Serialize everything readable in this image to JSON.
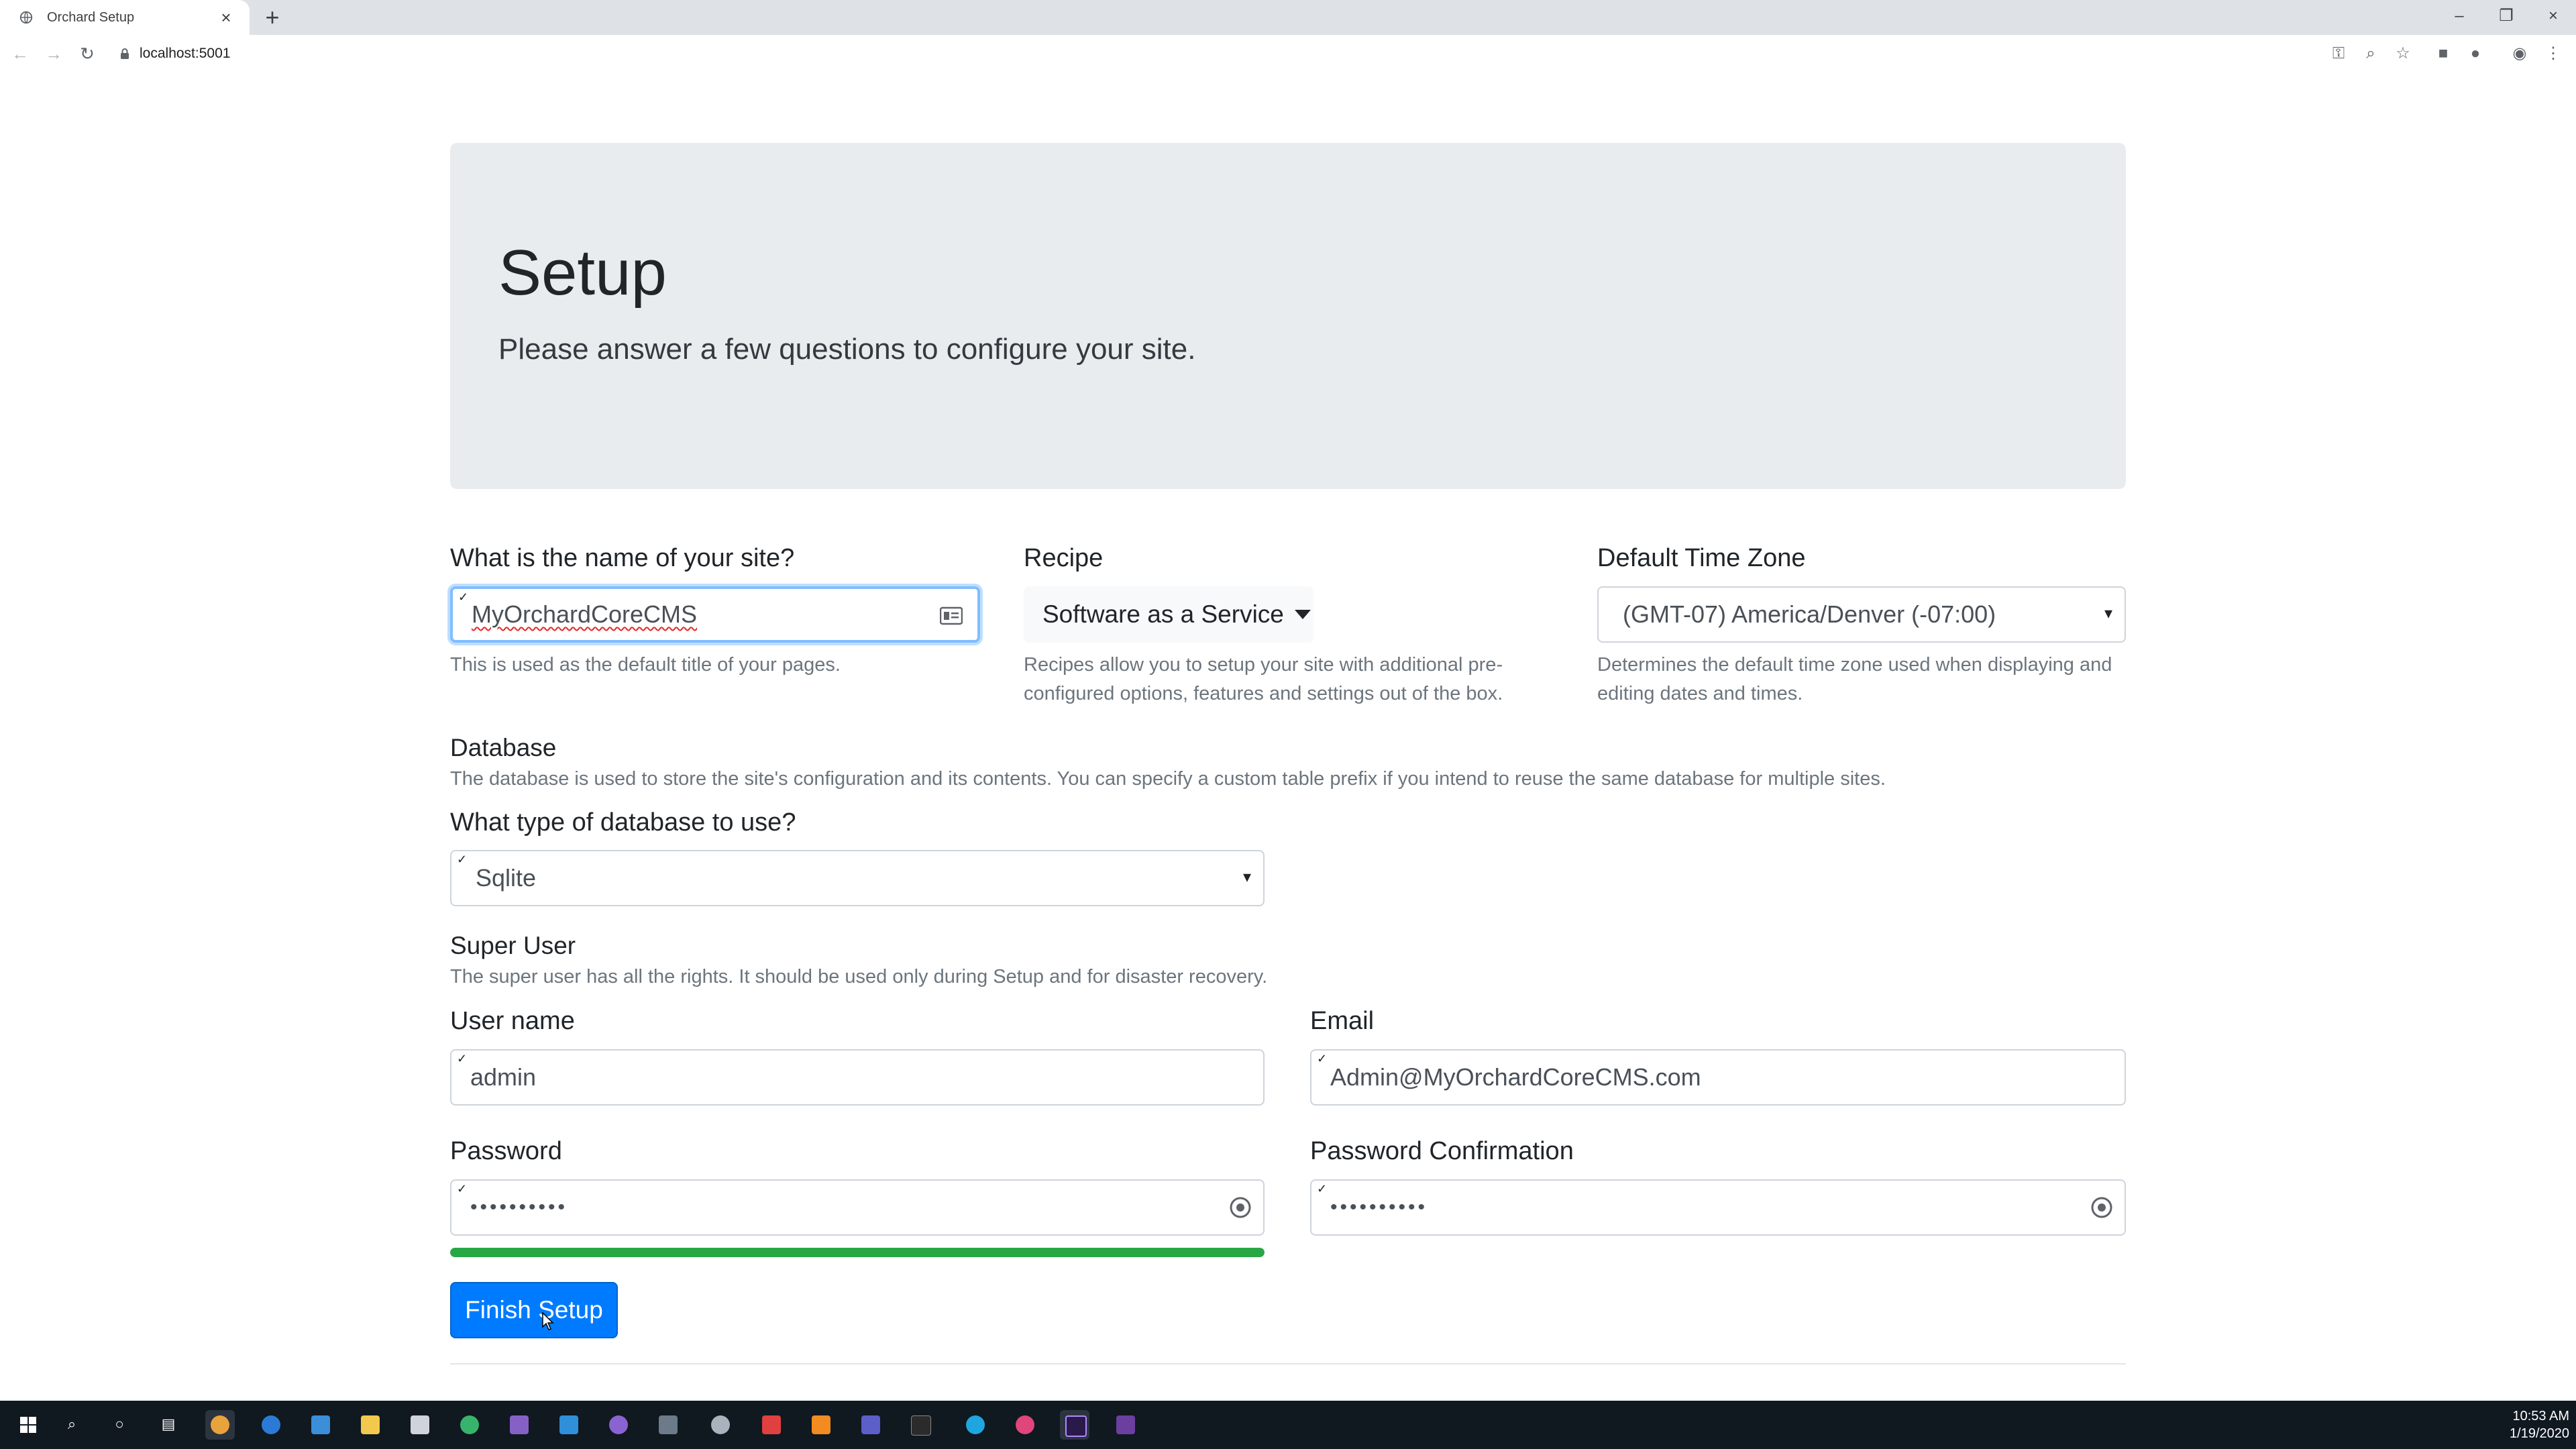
{
  "browser": {
    "tab_title": "Orchard Setup",
    "url": "localhost:5001"
  },
  "jumbotron": {
    "title": "Setup",
    "lead": "Please answer a few questions to configure your site."
  },
  "site_name": {
    "label": "What is the name of your site?",
    "value": "MyOrchardCoreCMS",
    "help": "This is used as the default title of your pages."
  },
  "recipe": {
    "label": "Recipe",
    "selected": "Software as a Service",
    "help_line1": "Recipes allow you to setup your site with additional pre-",
    "help_line2": "configured options, features and settings out of the box."
  },
  "timezone": {
    "label": "Default Time Zone",
    "selected": "(GMT-07) America/Denver (-07:00)",
    "help_line1": "Determines the default time zone used when displaying and",
    "help_line2": "editing dates and times."
  },
  "database": {
    "heading": "Database",
    "description": "The database is used to store the site's configuration and its contents. You can specify a custom table prefix if you intend to reuse the same database for multiple sites.",
    "type_label": "What type of database to use?",
    "type_selected": "Sqlite"
  },
  "super_user": {
    "heading": "Super User",
    "description": "The super user has all the rights. It should be used only during Setup and for disaster recovery.",
    "username_label": "User name",
    "username_value": "admin",
    "email_label": "Email",
    "email_value": "Admin@MyOrchardCoreCMS.com",
    "password_label": "Password",
    "password_value": "••••••••••",
    "password_confirm_label": "Password Confirmation",
    "password_confirm_value": "••••••••••",
    "password_strength": 1.0
  },
  "actions": {
    "finish_label": "Finish Setup"
  },
  "taskbar": {
    "time": "10:53 AM",
    "date": "1/19/2020"
  },
  "colors": {
    "primary": "#007bff",
    "success": "#28a745",
    "jumbotron_bg": "#e9ecef",
    "focus_border": "#80bdff"
  }
}
